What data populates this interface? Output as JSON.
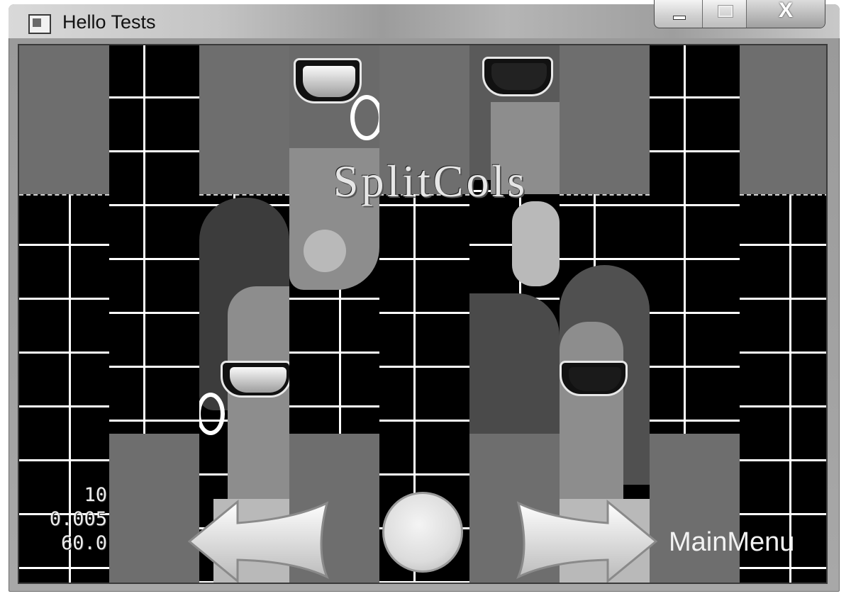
{
  "window": {
    "title": "Hello Tests",
    "close_glyph": "X"
  },
  "scene": {
    "title": "SplitCols",
    "stats": [
      "10",
      "0.005",
      "60.0"
    ],
    "menu_label": "MainMenu"
  },
  "icons": {
    "app": "app-window-icon",
    "minimize": "minimize-icon",
    "maximize": "maximize-icon",
    "close": "close-icon",
    "back": "left-arrow-icon",
    "restart": "circle-icon",
    "next": "right-arrow-icon"
  }
}
